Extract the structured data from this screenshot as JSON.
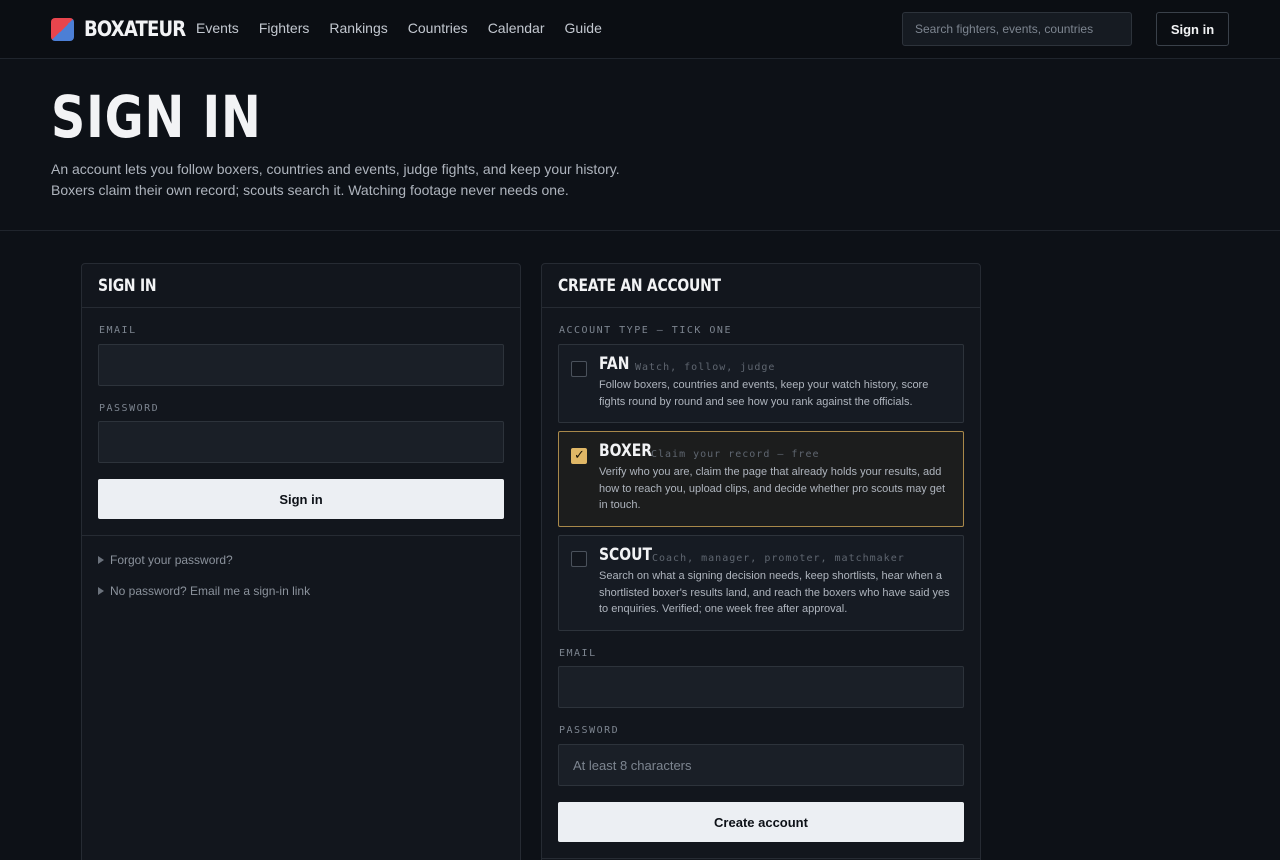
{
  "brand": {
    "name": "BOXATEUR"
  },
  "nav": [
    "Events",
    "Fighters",
    "Rankings",
    "Countries",
    "Calendar",
    "Guide"
  ],
  "search": {
    "placeholder": "Search fighters, events, countries"
  },
  "header": {
    "signin_label": "Sign in"
  },
  "hero": {
    "title": "SIGN IN",
    "line1": "An account lets you follow boxers, countries and events, judge fights, and keep your history.",
    "line2": "Boxers claim their own record; scouts search it. Watching footage never needs one."
  },
  "signin_card": {
    "title": "SIGN IN",
    "email_label": "EMAIL",
    "password_label": "PASSWORD",
    "submit_label": "Sign in",
    "forgot_label": "Forgot your password?",
    "magic_link_label": "No password? Email me a sign-in link"
  },
  "create_card": {
    "title": "CREATE AN ACCOUNT",
    "account_type_label": "ACCOUNT TYPE — TICK ONE",
    "options": [
      {
        "title": "FAN",
        "tag": "Watch, follow, judge",
        "description": "Follow boxers, countries and events, keep your watch history, score fights round by round and see how you rank against the officials.",
        "checked": false
      },
      {
        "title": "BOXER",
        "tag": "Claim your record — free",
        "description": "Verify who you are, claim the page that already holds your results, add how to reach you, upload clips, and decide whether pro scouts may get in touch.",
        "checked": true
      },
      {
        "title": "SCOUT",
        "tag": "Coach, manager, promoter, matchmaker",
        "description": "Search on what a signing decision needs, keep shortlists, hear when a shortlisted boxer's results land, and reach the boxers who have said yes to enquiries. Verified; one week free after approval.",
        "checked": false
      }
    ],
    "email_label": "EMAIL",
    "password_label": "PASSWORD",
    "password_placeholder": "At least 8 characters",
    "submit_label": "Create account"
  },
  "colors": {
    "background": "#0d1117",
    "panel": "#12161d",
    "accent_gold": "#e0b766",
    "brand_red": "#e8454d",
    "brand_blue": "#4c7fd6"
  }
}
